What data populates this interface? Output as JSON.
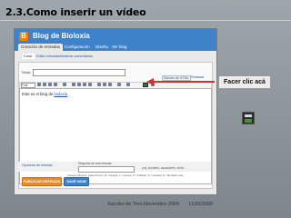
{
  "slide": {
    "title": "2.3.Como inserir un vídeo",
    "callout_text": "Facer clic acá"
  },
  "blogger": {
    "blog_name": "Blog de Bioloxía",
    "logo_letter": "B",
    "tabs": [
      "Creación de entradas",
      "Configuración",
      "Diseño",
      "Ver blog"
    ],
    "subtabs": [
      "Crear",
      "Editar entradas",
      "Moderar comentarios"
    ],
    "title_label": "Título:",
    "link_edit_html": "Edición de HTML",
    "link_compose": "Redactar",
    "link_preview": "Vista previa",
    "font_select": "Font",
    "editor_text_prefix": "Este es el blog de ",
    "editor_text_link": "bioloxía",
    "post_options": "Opciones de entrada",
    "labels_title": "Etiquetas de esta entrada:",
    "labels_hint": "p.ej. scooters, vacaciones, otoño",
    "shortcuts": "Accesos directos: pulsa Ctrl con: B = Negrita, I = Cursiva, P = Publicar, S = Guardar, D = Borrador más",
    "publish_button": "PUBLICAR ENTRADA",
    "save_button": "SAVE NOW"
  },
  "footer": {
    "author": "Xacobo de Toro.Novembro 2009",
    "date": "11/20/2009"
  },
  "colors": {
    "blogger_blue": "#3e82c9",
    "publish_orange": "#f08a1e",
    "arrow_red": "#d33030"
  }
}
